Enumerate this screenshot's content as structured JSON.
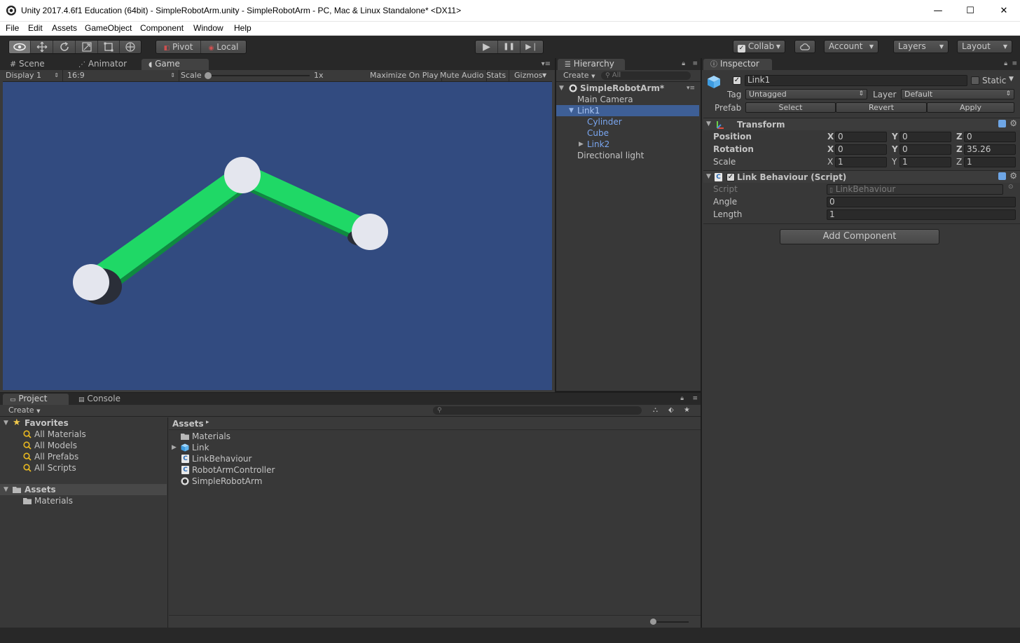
{
  "window": {
    "title": "Unity 2017.4.6f1 Education (64bit) - SimpleRobotArm.unity - SimpleRobotArm - PC, Mac & Linux Standalone* <DX11>",
    "minimize_glyph": "—",
    "maximize_glyph": "☐",
    "close_glyph": "✕"
  },
  "menu": [
    "File",
    "Edit",
    "Assets",
    "GameObject",
    "Component",
    "Window",
    "Help"
  ],
  "toolbar": {
    "pivot_label": "Pivot",
    "local_label": "Local",
    "collab_label": "Collab",
    "account_label": "Account",
    "layers_label": "Layers",
    "layout_label": "Layout",
    "play_glyph": "▶",
    "pause_glyph": "❚❚",
    "step_glyph": "▶❘"
  },
  "viewport": {
    "tabs": [
      "Scene",
      "Animator",
      "Game"
    ],
    "active_tab": "Game",
    "display_label": "Display 1",
    "aspect_label": "16:9",
    "scale_label": "Scale",
    "scale_value": "1x",
    "maximize_on_play": "Maximize On Play",
    "mute_audio": "Mute Audio",
    "stats": "Stats",
    "gizmos": "Gizmos",
    "background_color": "#324b80",
    "link_color": "#1fd866",
    "joint_color": "#e4e6ee"
  },
  "hierarchy": {
    "tab": "Hierarchy",
    "create_label": "Create",
    "search_placeholder": "All",
    "scene": "SimpleRobotArm*",
    "items": [
      {
        "label": "Main Camera"
      },
      {
        "label": "Link1"
      },
      {
        "label": "Cylinder"
      },
      {
        "label": "Cube"
      },
      {
        "label": "Link2"
      },
      {
        "label": "Directional light"
      }
    ],
    "selected_color": "#3e5f96"
  },
  "inspector": {
    "tab": "Inspector",
    "object_name": "Link1",
    "static_label": "Static",
    "tag_label": "Tag",
    "tag_value": "Untagged",
    "layer_label": "Layer",
    "layer_value": "Default",
    "prefab_label": "Prefab",
    "prefab_select": "Select",
    "prefab_revert": "Revert",
    "prefab_apply": "Apply",
    "transform": {
      "title": "Transform",
      "position_label": "Position",
      "rotation_label": "Rotation",
      "scale_label": "Scale",
      "axis_x": "X",
      "axis_y": "Y",
      "axis_z": "Z",
      "position": [
        "0",
        "0",
        "0"
      ],
      "rotation": [
        "0",
        "0",
        "35.26"
      ],
      "scale": [
        "1",
        "1",
        "1"
      ]
    },
    "link_behaviour": {
      "title": "Link Behaviour (Script)",
      "script_label": "Script",
      "script_value": "LinkBehaviour",
      "angle_label": "Angle",
      "angle_value": "0",
      "length_label": "Length",
      "length_value": "1"
    },
    "add_component": "Add Component"
  },
  "project": {
    "tabs": [
      "Project",
      "Console"
    ],
    "create_label": "Create",
    "favorites_label": "Favorites",
    "favorites": [
      "All Materials",
      "All Models",
      "All Prefabs",
      "All Scripts"
    ],
    "assets_label": "Assets",
    "assets_tree": [
      "Materials"
    ],
    "breadcrumb": "Assets",
    "breadcrumb_arrow": "▸",
    "files": [
      "Materials",
      "Link",
      "LinkBehaviour",
      "RobotArmController",
      "SimpleRobotArm"
    ]
  }
}
